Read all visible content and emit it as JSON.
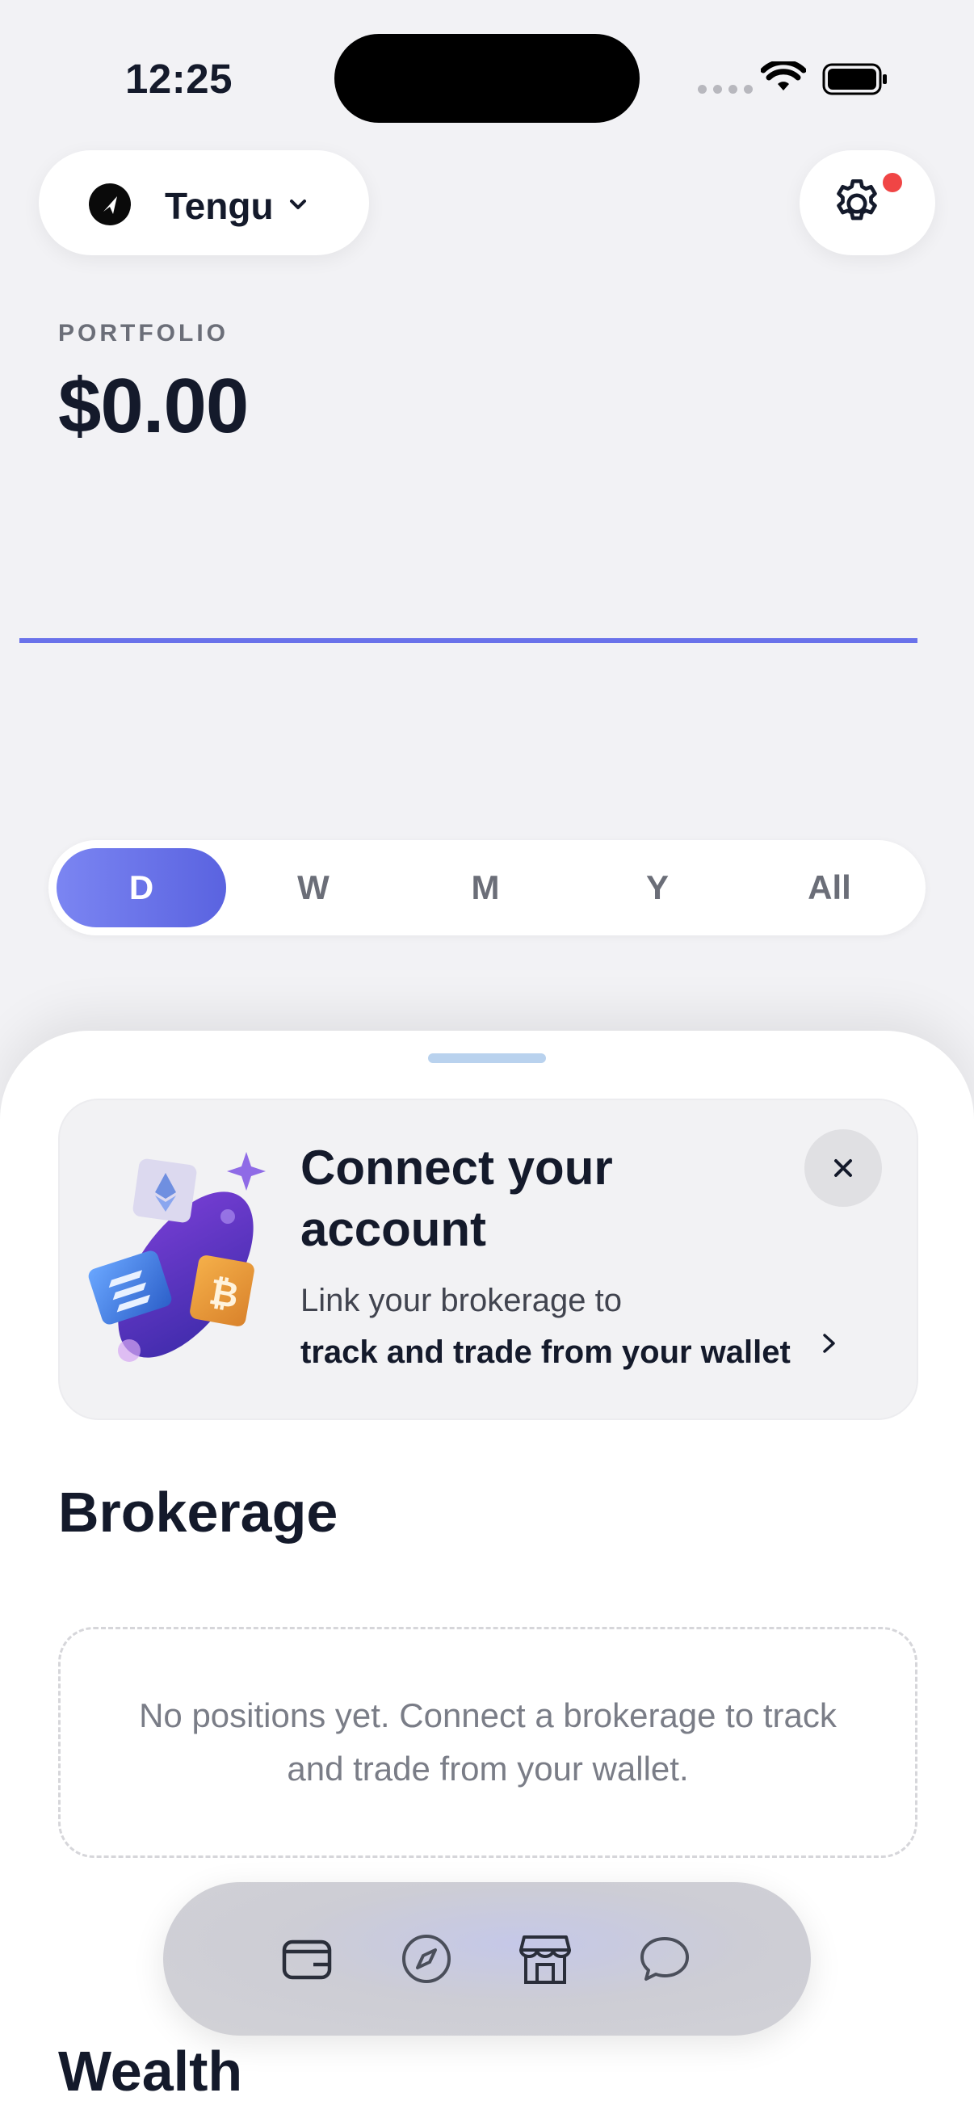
{
  "status_bar": {
    "time": "12:25"
  },
  "header": {
    "account_name": "Tengu",
    "account_icon": "navigation-arrow-icon",
    "settings_icon": "gear-icon",
    "settings_has_notification": true
  },
  "portfolio": {
    "label": "PORTFOLIO",
    "value": "$0.00"
  },
  "timeframes": {
    "selected": "D",
    "options": [
      "D",
      "W",
      "M",
      "Y",
      "All"
    ]
  },
  "connect_card": {
    "title": "Connect your account",
    "line1": "Link your brokerage to",
    "line2": "track and trade from your wallet"
  },
  "brokerage": {
    "title": "Brokerage",
    "empty_text": "No positions yet. Connect a brokerage to track and trade from your wallet."
  },
  "wealth": {
    "title": "Wealth"
  },
  "tab_bar": {
    "items": [
      "wallet-icon",
      "compass-icon",
      "store-icon",
      "chat-icon"
    ]
  },
  "colors": {
    "accent": "#6a72ea",
    "notification": "#f04545",
    "text_primary": "#141a2b"
  }
}
